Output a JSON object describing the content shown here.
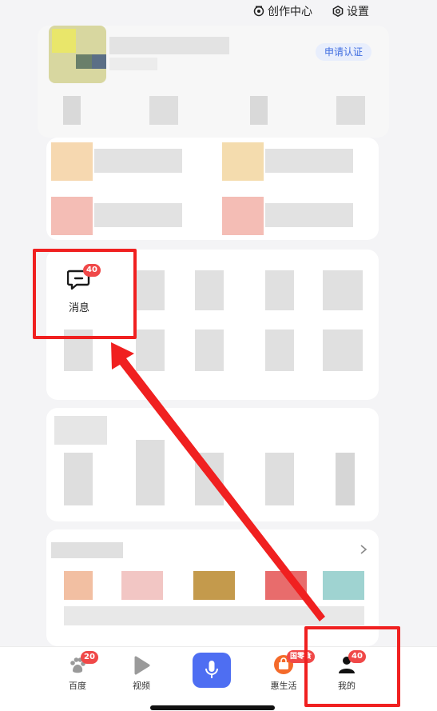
{
  "header": {
    "creation_center_label": "创作中心",
    "settings_label": "设置"
  },
  "profile": {
    "apply_cert_label": "申请认证"
  },
  "messages": {
    "label": "消息",
    "badge": "40"
  },
  "bottom_nav": {
    "items": [
      {
        "label": "百度",
        "badge": "20"
      },
      {
        "label": "视频"
      },
      {
        "label": ""
      },
      {
        "label": "惠生活",
        "badge": "国零食"
      },
      {
        "label": "我的",
        "badge": "40"
      }
    ]
  },
  "colors": {
    "accent_blue": "#4e6ef2",
    "badge_red": "#f04848",
    "annotation_red": "#f02020",
    "apply_text": "#3f6de0"
  },
  "annotation_arrow": {
    "from": "my-tab",
    "to": "messages-tile"
  }
}
